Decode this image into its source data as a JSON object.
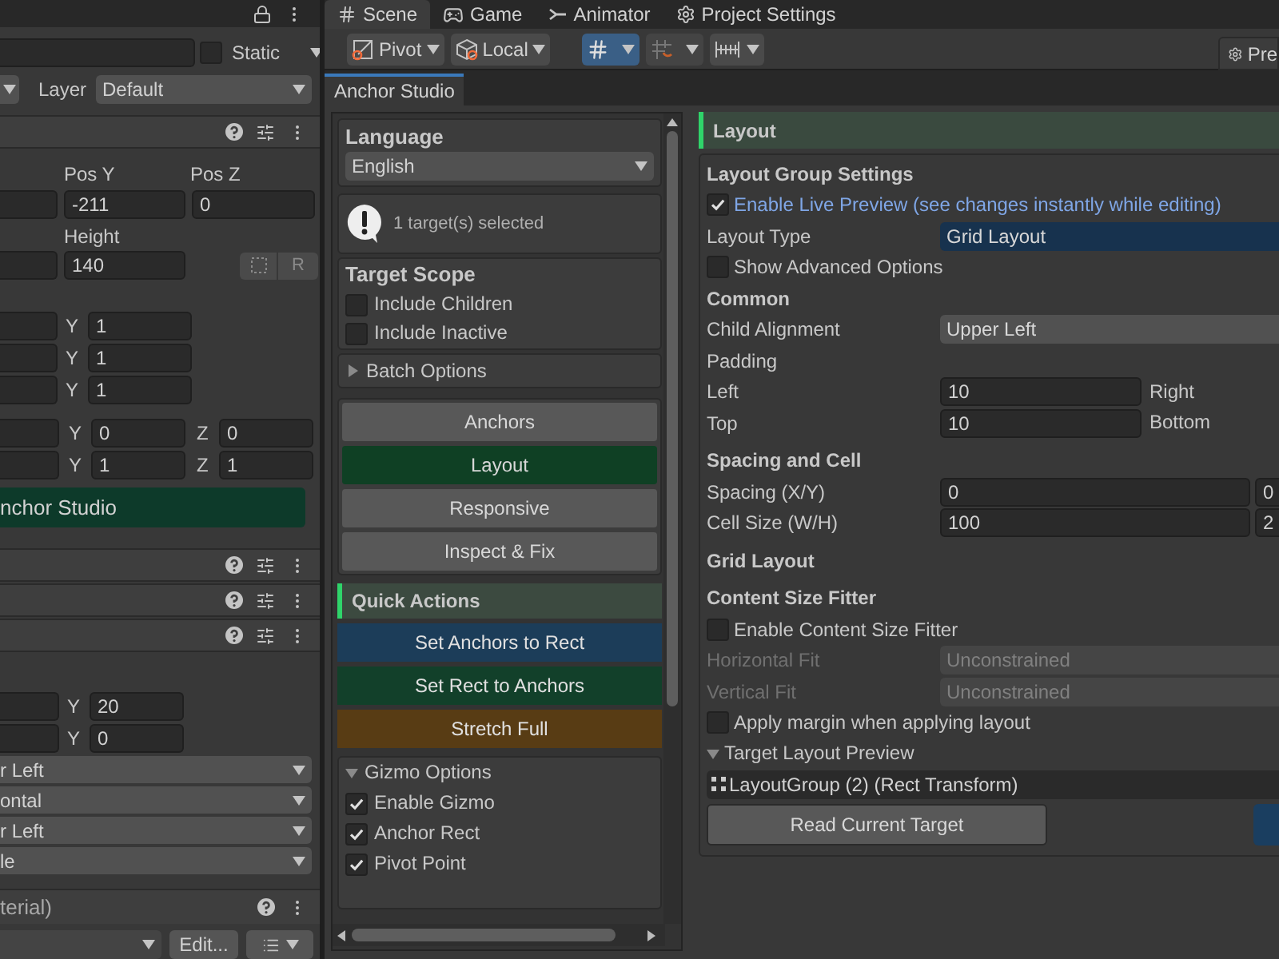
{
  "inspector": {
    "static_label": "Static",
    "static_checked": false,
    "layer_label": "Layer",
    "layer_value": "Default",
    "pos_labels": [
      "Pos Y",
      "Pos Z"
    ],
    "pos_values": [
      "-211",
      "0"
    ],
    "height_label": "Height",
    "height_value": "140",
    "r_button": "R",
    "vector_rows": [
      {
        "label": "Y",
        "value": "1"
      },
      {
        "label": "Y",
        "value": "1"
      },
      {
        "label": "Y",
        "value": "1"
      }
    ],
    "xyz_rows": [
      {
        "label": "Y",
        "value": "0",
        "label_2": "Z",
        "value_2": "0"
      },
      {
        "label": "Y",
        "value": "1",
        "label_2": "Z",
        "value_2": "1"
      }
    ],
    "anchor_studio_button": "nchor Studio",
    "layout_rows": [
      {
        "label": "Y",
        "value": "20"
      },
      {
        "label": "Y",
        "value": "0"
      }
    ],
    "dropdowns": [
      "r Left",
      "ontal",
      "r Left",
      "le"
    ],
    "material_header": "terial)",
    "edit_button": "Edit..."
  },
  "editor_tabs": [
    {
      "label": "Scene",
      "selected": true
    },
    {
      "label": "Game",
      "selected": false
    },
    {
      "label": "Animator",
      "selected": false
    },
    {
      "label": "Project Settings",
      "selected": false
    }
  ],
  "toolbar": {
    "pivot": "Pivot",
    "local": "Local",
    "grid_snap_on": true,
    "preview_button": "Pre"
  },
  "window_tab": "Anchor Studio",
  "sidebar": {
    "language_label": "Language",
    "language_value": "English",
    "selection_message": "1 target(s) selected",
    "target_scope": {
      "title": "Target Scope",
      "options": [
        {
          "label": "Include Children",
          "checked": false
        },
        {
          "label": "Include Inactive",
          "checked": false
        }
      ]
    },
    "batch_options": {
      "label": "Batch Options",
      "expanded": false
    },
    "modes": [
      {
        "label": "Anchors",
        "selected": false
      },
      {
        "label": "Layout",
        "selected": true
      },
      {
        "label": "Responsive",
        "selected": false
      },
      {
        "label": "Inspect & Fix",
        "selected": false
      }
    ],
    "quick_actions": {
      "title": "Quick Actions",
      "buttons": [
        {
          "label": "Set Anchors to Rect",
          "color": "#1c3d59"
        },
        {
          "label": "Set Rect to Anchors",
          "color": "#12402a"
        },
        {
          "label": "Stretch Full",
          "color": "#583c14"
        }
      ]
    },
    "gizmo_options": {
      "label": "Gizmo Options",
      "expanded": true,
      "options": [
        {
          "label": "Enable Gizmo",
          "checked": true
        },
        {
          "label": "Anchor Rect",
          "checked": true
        },
        {
          "label": "Pivot Point",
          "checked": true
        }
      ]
    }
  },
  "layout_panel": {
    "title": "Layout",
    "group_title": "Layout Group Settings",
    "live_preview": {
      "label": "Enable Live Preview (see changes instantly while editing)",
      "checked": true
    },
    "layout_type": {
      "label": "Layout Type",
      "value": "Grid Layout"
    },
    "show_advanced": {
      "label": "Show Advanced Options",
      "checked": false
    },
    "common_title": "Common",
    "child_alignment": {
      "label": "Child Alignment",
      "value": "Upper Left"
    },
    "padding_label": "Padding",
    "padding_rows": [
      {
        "label": "Left",
        "value": "10",
        "label_2": "Right"
      },
      {
        "label": "Top",
        "value": "10",
        "label_2": "Bottom"
      }
    ],
    "spacing_title": "Spacing and Cell",
    "spacing_rows": [
      {
        "label": "Spacing (X/Y)",
        "value": "0",
        "value_2": "0"
      },
      {
        "label": "Cell Size (W/H)",
        "value": "100",
        "value_2": "2"
      }
    ],
    "grid_title": "Grid Layout",
    "fitter_title": "Content Size Fitter",
    "enable_fitter": {
      "label": "Enable Content Size Fitter",
      "checked": false
    },
    "fit_rows": [
      {
        "label": "Horizontal Fit",
        "value": "Unconstrained",
        "disabled": true
      },
      {
        "label": "Vertical Fit",
        "value": "Unconstrained",
        "disabled": true
      }
    ],
    "apply_margin": {
      "label": "Apply margin when applying layout",
      "checked": false
    },
    "preview": {
      "label": "Target Layout Preview",
      "expanded": true
    },
    "target_object": "LayoutGroup (2) (Rect Transform)",
    "read_button": "Read Current Target"
  }
}
